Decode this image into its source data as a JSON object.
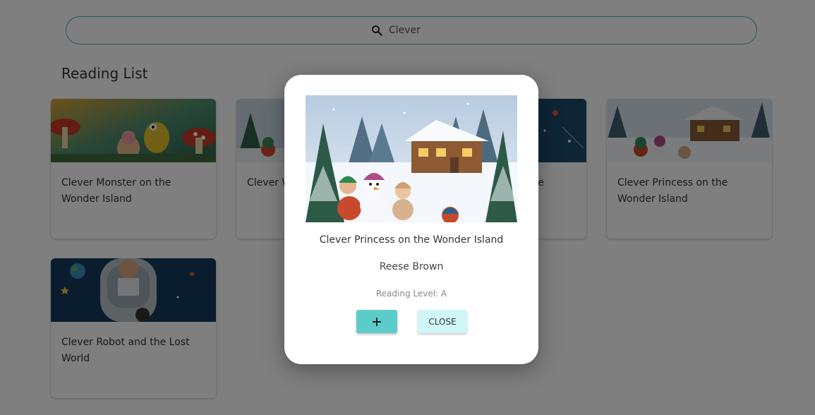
{
  "search": {
    "value": "Clever",
    "icon": "search-icon"
  },
  "reading_list": {
    "title": "Reading List",
    "cards": [
      {
        "title": "Clever Monster on the Wonder Island"
      },
      {
        "title": "Clever Wizard and the Sky"
      },
      {
        "title": "Clever Dragon and the Secret"
      },
      {
        "title": "Clever Princess on the Wonder Island"
      },
      {
        "title": "Clever Robot and the Lost World"
      }
    ]
  },
  "modal": {
    "title": "Clever Princess on the Wonder Island",
    "author": "Reese Brown",
    "reading_level": "Reading Level: A",
    "add_icon": "plus-icon",
    "close_label": "CLOSE"
  },
  "colors": {
    "accent": "#3bb6b2",
    "add_button": "#5ccccb",
    "close_button": "#cff7f7"
  }
}
